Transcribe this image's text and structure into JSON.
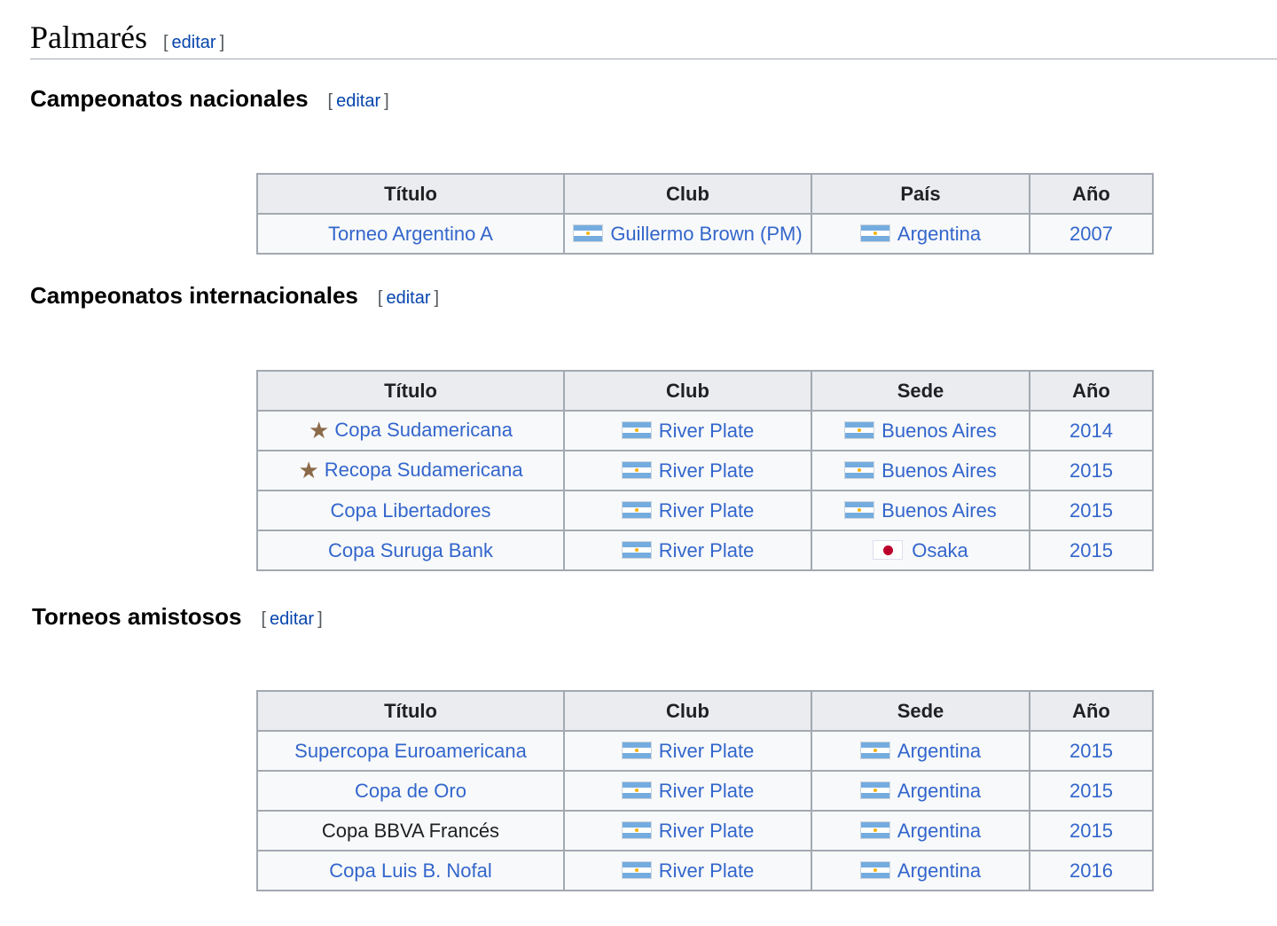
{
  "heading": {
    "title": "Palmarés",
    "edit_label": "editar"
  },
  "sections": [
    {
      "title": "Campeonatos nacionales",
      "edit_label": "editar",
      "headers": [
        "Título",
        "Club",
        "País",
        "Año"
      ],
      "rows": [
        {
          "titulo": "Torneo Argentino A",
          "club": "Guillermo Brown (PM)",
          "lugar": "Argentina",
          "anio": "2007"
        }
      ]
    },
    {
      "title": "Campeonatos internacionales",
      "edit_label": "editar",
      "headers": [
        "Título",
        "Club",
        "Sede",
        "Año"
      ],
      "rows": [
        {
          "titulo": "Copa Sudamericana",
          "club": "River Plate",
          "lugar": "Buenos Aires",
          "anio": "2014"
        },
        {
          "titulo": "Recopa Sudamericana",
          "club": "River Plate",
          "lugar": "Buenos Aires",
          "anio": "2015"
        },
        {
          "titulo": "Copa Libertadores",
          "club": "River Plate",
          "lugar": "Buenos Aires",
          "anio": "2015"
        },
        {
          "titulo": "Copa Suruga Bank",
          "club": "River Plate",
          "lugar": "Osaka",
          "anio": "2015"
        }
      ]
    },
    {
      "title": "Torneos amistosos",
      "edit_label": "editar",
      "headers": [
        "Título",
        "Club",
        "Sede",
        "Año"
      ],
      "rows": [
        {
          "titulo": "Supercopa Euroamericana",
          "club": "River Plate",
          "lugar": "Argentina",
          "anio": "2015"
        },
        {
          "titulo": "Copa de Oro",
          "club": "River Plate",
          "lugar": "Argentina",
          "anio": "2015"
        },
        {
          "titulo": "Copa BBVA Francés",
          "club": "River Plate",
          "lugar": "Argentina",
          "anio": "2015"
        },
        {
          "titulo": "Copa Luis B. Nofal",
          "club": "River Plate",
          "lugar": "Argentina",
          "anio": "2016"
        }
      ]
    }
  ]
}
